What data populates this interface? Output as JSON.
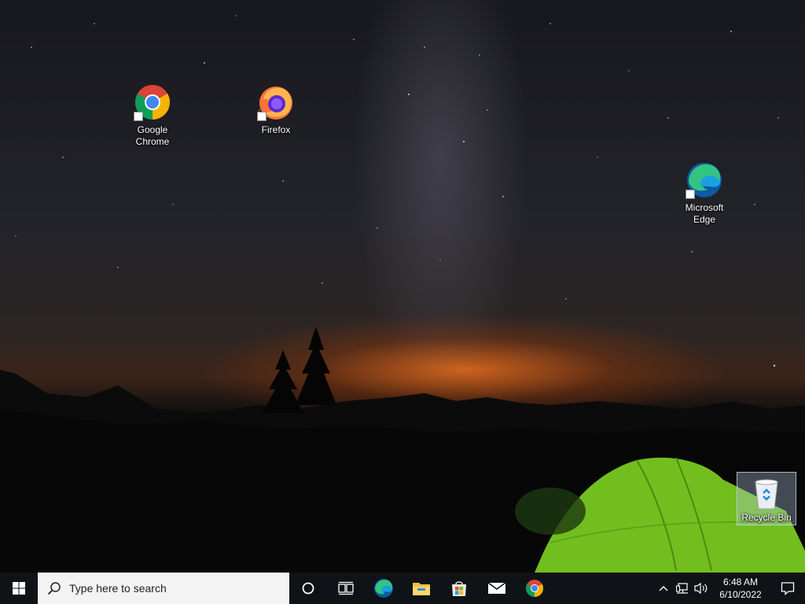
{
  "desktop": {
    "icons": [
      {
        "label": "Google Chrome"
      },
      {
        "label": "Firefox"
      },
      {
        "label": "Microsoft Edge"
      },
      {
        "label": "Recycle Bin"
      }
    ]
  },
  "taskbar": {
    "search_placeholder": "Type here to search",
    "pinned": [
      "cortana-icon",
      "task-view-icon",
      "edge-icon",
      "file-explorer-icon",
      "store-icon",
      "mail-icon",
      "chrome-icon"
    ],
    "clock": {
      "time": "6:48 AM",
      "date": "6/10/2022"
    }
  },
  "colors": {
    "taskbar_bg": "#0f1216",
    "search_bg": "#f3f3f3",
    "sky_glow": "#ff7a1e",
    "tent": "#7ed321"
  }
}
